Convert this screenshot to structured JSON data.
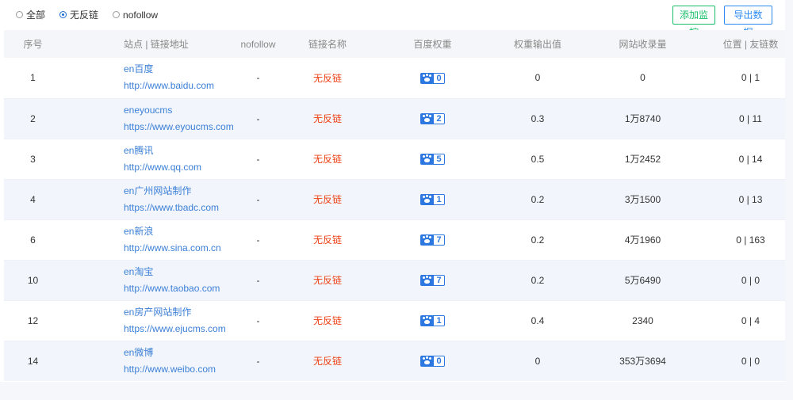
{
  "filters": {
    "options": [
      {
        "label": "全部",
        "checked": false
      },
      {
        "label": "无反链",
        "checked": true
      },
      {
        "label": "nofollow",
        "checked": false
      }
    ]
  },
  "toolbar": {
    "add_monitor_label": "添加监控",
    "export_label": "导出数据"
  },
  "colors": {
    "accent_blue": "#2d8cf0",
    "accent_green": "#19be6b",
    "status_red": "#ed4014",
    "link_blue": "#3b7fd6"
  },
  "table": {
    "columns": [
      "序号",
      "站点 | 链接地址",
      "nofollow",
      "链接名称",
      "百度权重",
      "权重输出值",
      "网站收录量",
      "位置 | 友链数"
    ],
    "rows": [
      {
        "id": "1",
        "site_name": "en百度",
        "url": "http://www.baidu.com",
        "nofollow": "-",
        "link_name": "无反链",
        "baidu_rank": "0",
        "weight_out": "0",
        "indexed": "0",
        "position": "0 | 1"
      },
      {
        "id": "2",
        "site_name": "eneyoucms",
        "url": "https://www.eyoucms.com",
        "nofollow": "-",
        "link_name": "无反链",
        "baidu_rank": "2",
        "weight_out": "0.3",
        "indexed": "1万8740",
        "position": "0 | 11"
      },
      {
        "id": "3",
        "site_name": "en腾讯",
        "url": "http://www.qq.com",
        "nofollow": "-",
        "link_name": "无反链",
        "baidu_rank": "5",
        "weight_out": "0.5",
        "indexed": "1万2452",
        "position": "0 | 14"
      },
      {
        "id": "4",
        "site_name": "en广州网站制作",
        "url": "https://www.tbadc.com",
        "nofollow": "-",
        "link_name": "无反链",
        "baidu_rank": "1",
        "weight_out": "0.2",
        "indexed": "3万1500",
        "position": "0 | 13"
      },
      {
        "id": "6",
        "site_name": "en新浪",
        "url": "http://www.sina.com.cn",
        "nofollow": "-",
        "link_name": "无反链",
        "baidu_rank": "7",
        "weight_out": "0.2",
        "indexed": "4万1960",
        "position": "0 | 163"
      },
      {
        "id": "10",
        "site_name": "en淘宝",
        "url": "http://www.taobao.com",
        "nofollow": "-",
        "link_name": "无反链",
        "baidu_rank": "7",
        "weight_out": "0.2",
        "indexed": "5万6490",
        "position": "0 | 0"
      },
      {
        "id": "12",
        "site_name": "en房产网站制作",
        "url": "https://www.ejucms.com",
        "nofollow": "-",
        "link_name": "无反链",
        "baidu_rank": "1",
        "weight_out": "0.4",
        "indexed": "2340",
        "position": "0 | 4"
      },
      {
        "id": "14",
        "site_name": "en微博",
        "url": "http://www.weibo.com",
        "nofollow": "-",
        "link_name": "无反链",
        "baidu_rank": "0",
        "weight_out": "0",
        "indexed": "353万3694",
        "position": "0 | 0"
      }
    ]
  }
}
